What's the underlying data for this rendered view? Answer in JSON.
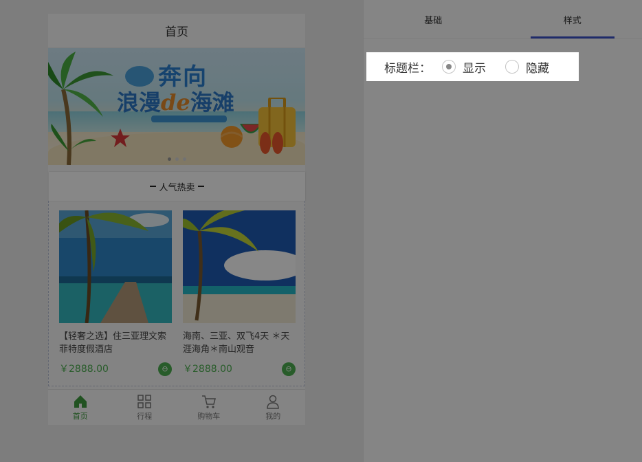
{
  "phone": {
    "title": "首页",
    "banner": {
      "line1": "奔向",
      "line2_a": "浪漫",
      "line2_de": "de",
      "line2_b": "海滩"
    },
    "section_title": "人气热卖",
    "products": [
      {
        "name": "【轻奢之选】住三亚理文索菲特度假酒店",
        "price": "￥2888.00"
      },
      {
        "name": "海南、三亚、双飞4天 ＊天涯海角＊南山观音",
        "price": "￥2888.00"
      }
    ],
    "tabbar": [
      {
        "label": "首页",
        "icon": "home-icon",
        "active": true
      },
      {
        "label": "行程",
        "icon": "grid-icon",
        "active": false
      },
      {
        "label": "购物车",
        "icon": "cart-icon",
        "active": false
      },
      {
        "label": "我的",
        "icon": "user-icon",
        "active": false
      }
    ]
  },
  "editor": {
    "tabs": [
      {
        "label": "基础",
        "active": false
      },
      {
        "label": "样式",
        "active": true
      }
    ],
    "titlebar_setting": {
      "label": "标题栏：",
      "options": [
        {
          "label": "显示",
          "checked": true
        },
        {
          "label": "隐藏",
          "checked": false
        }
      ]
    }
  },
  "colors": {
    "accent_green": "#4caf50",
    "tab_indicator": "#3b52c8",
    "overlay": "rgba(0,0,0,0.47)"
  }
}
